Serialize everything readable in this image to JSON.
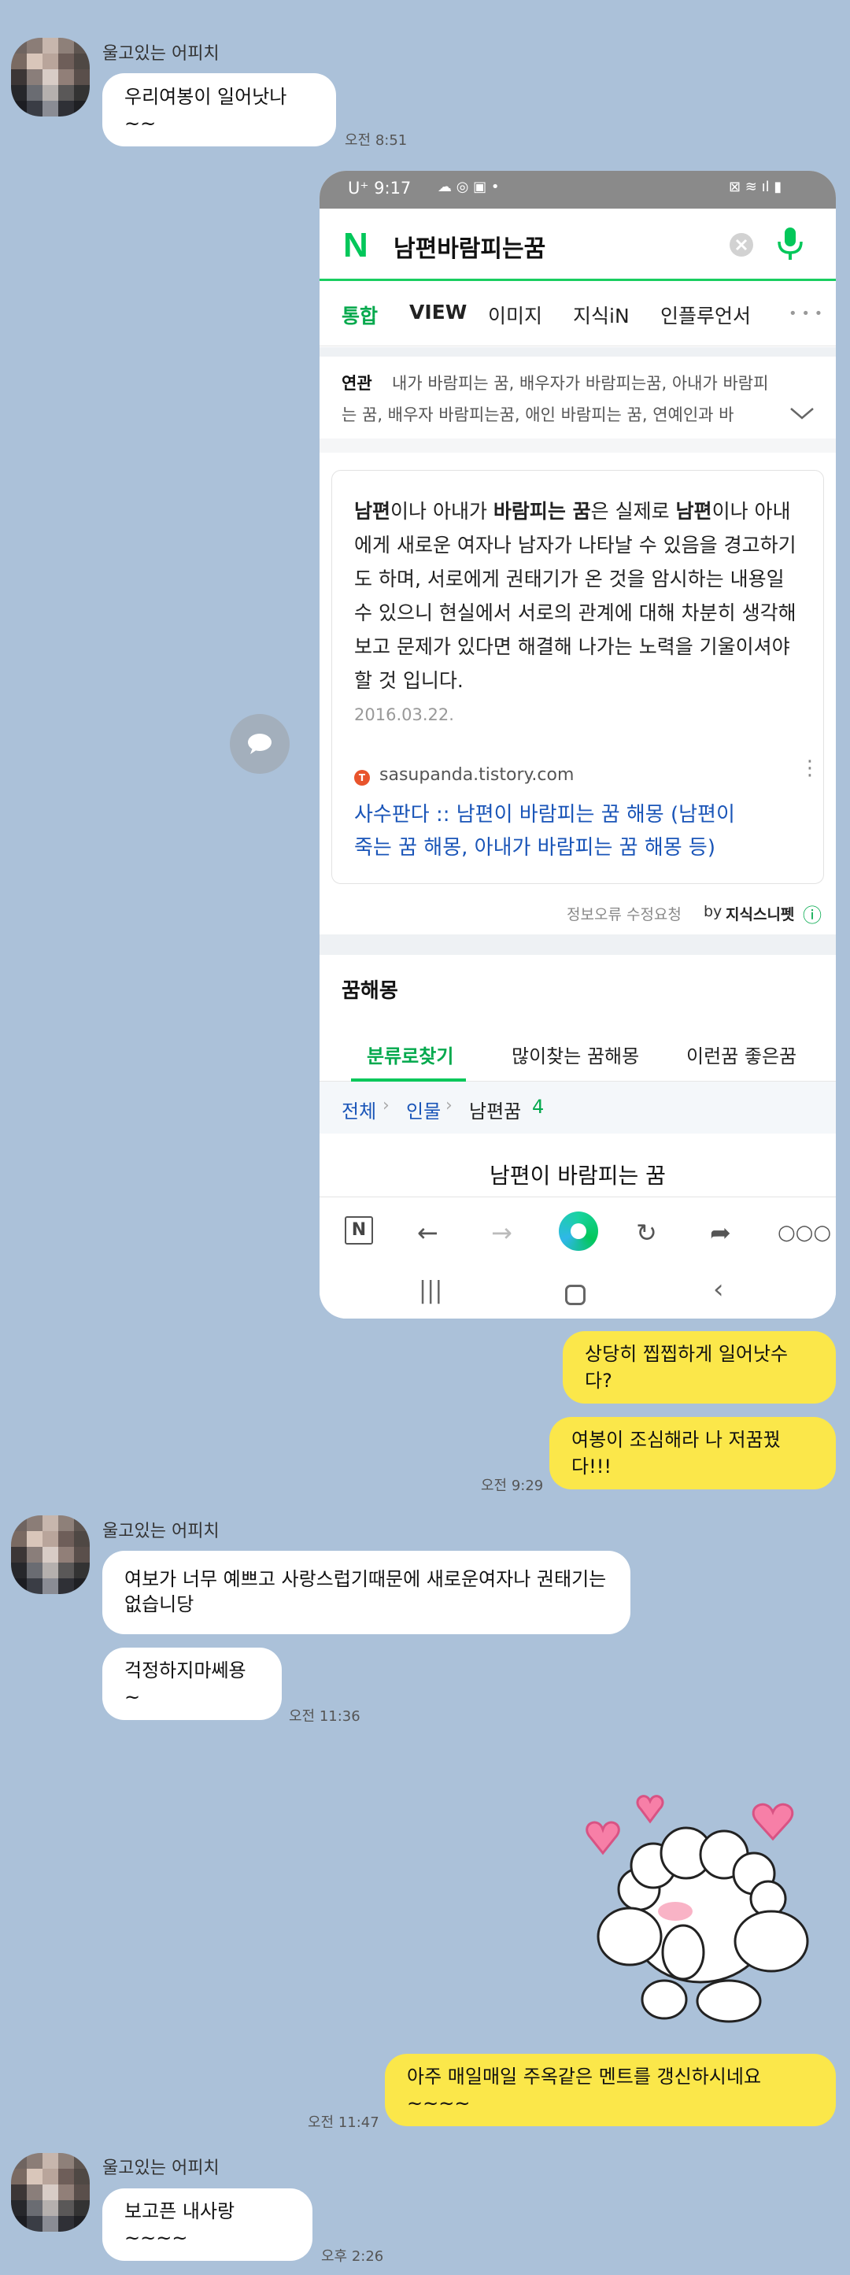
{
  "chat": {
    "sender_name": "울고있는 어피치",
    "messages": [
      {
        "text": "우리여봉이 일어낫나~~"
      },
      {
        "time": "오전 8:51"
      },
      {
        "text": "상당히 찝찝하게 일어낫수다?"
      },
      {
        "text": "여봉이 조심해라 나 저꿈꿨다!!!"
      },
      {
        "time": "오전 9:29"
      },
      {
        "text": "여보가 너무 예쁘고 사랑스럽기때문에 새로운여자나 권태기는\n없습니당"
      },
      {
        "text": "걱정하지마쎄용~"
      },
      {
        "time": "오전 11:36"
      },
      {
        "text": "아주 매일매일 주옥같은 멘트를 갱신하시네요~~~~"
      },
      {
        "time": "오전 11:47"
      },
      {
        "text": "보고픈 내사랑~~~~"
      },
      {
        "time": "오후 2:26"
      }
    ]
  },
  "phone": {
    "status": {
      "carrier": "U⁺ 9:17",
      "icons": "☁ ◎ ▣ •",
      "right_icons": "⊠ ≋ ıl ▮"
    },
    "search": {
      "query": "남편바람피는꿈",
      "logo": "N",
      "clear_icon": "clear-icon",
      "mic_icon": "mic-icon"
    },
    "tabs": [
      "통합",
      "VIEW",
      "이미지",
      "지식iN",
      "인플루언서"
    ],
    "more": "• • •",
    "related": {
      "label": "연관",
      "line1": "내가 바람피는 꿈, 배우자가 바람피는꿈, 아내가 바람피",
      "line2": "는 꿈, 배우자 바람피는꿈, 애인 바람피는 꿈, 연예인과 바"
    },
    "snippet": {
      "t1": "남편",
      "t2": "이나 아내가 ",
      "t3": "바람피는 꿈",
      "t4": "은 실제로 ",
      "t5": "남편",
      "t6": "이나 아",
      "rest": "내에게 새로운 여자나 남자가 나타날 수 있음을 경고하기도 하며, 서로에게 권태기가 온 것을 암시하는 내용일 수 있으니 현실에서 서로의 관계에 대해 차분히 생각해보고 문제가 있다면 해결해 나가는 노력을 기울이셔야 할 것 입니다.",
      "date": "2016.03.22.",
      "site": "sasupanda.tistory.com",
      "site_initial": "T",
      "title_line1": "사수판다 :: 남편이 바람피는 꿈 해몽 (남편이",
      "title_line2": "죽는 꿈 해몽, 아내가 바람피는 꿈 해몽 등)"
    },
    "report": {
      "error_link": "정보오류 수정요청",
      "by": "by",
      "provider": "지식스니펫",
      "info_icon": "ⓘ"
    },
    "dream": {
      "title": "꿈해몽",
      "tabs": [
        "분류로찾기",
        "많이찾는 꿈해몽",
        "이런꿈 좋은꿈"
      ],
      "crumbs": [
        "전체",
        "인물",
        "남편꿈"
      ],
      "count": "4",
      "result_title": "남편이 바람피는 꿈"
    },
    "toolbar": {
      "home_glyph": "N"
    }
  },
  "colors": {
    "background": "#abc1d9",
    "yellow_bubble": "#fbe74a",
    "naver_green": "#03c75a",
    "link_blue": "#1a55b8"
  }
}
